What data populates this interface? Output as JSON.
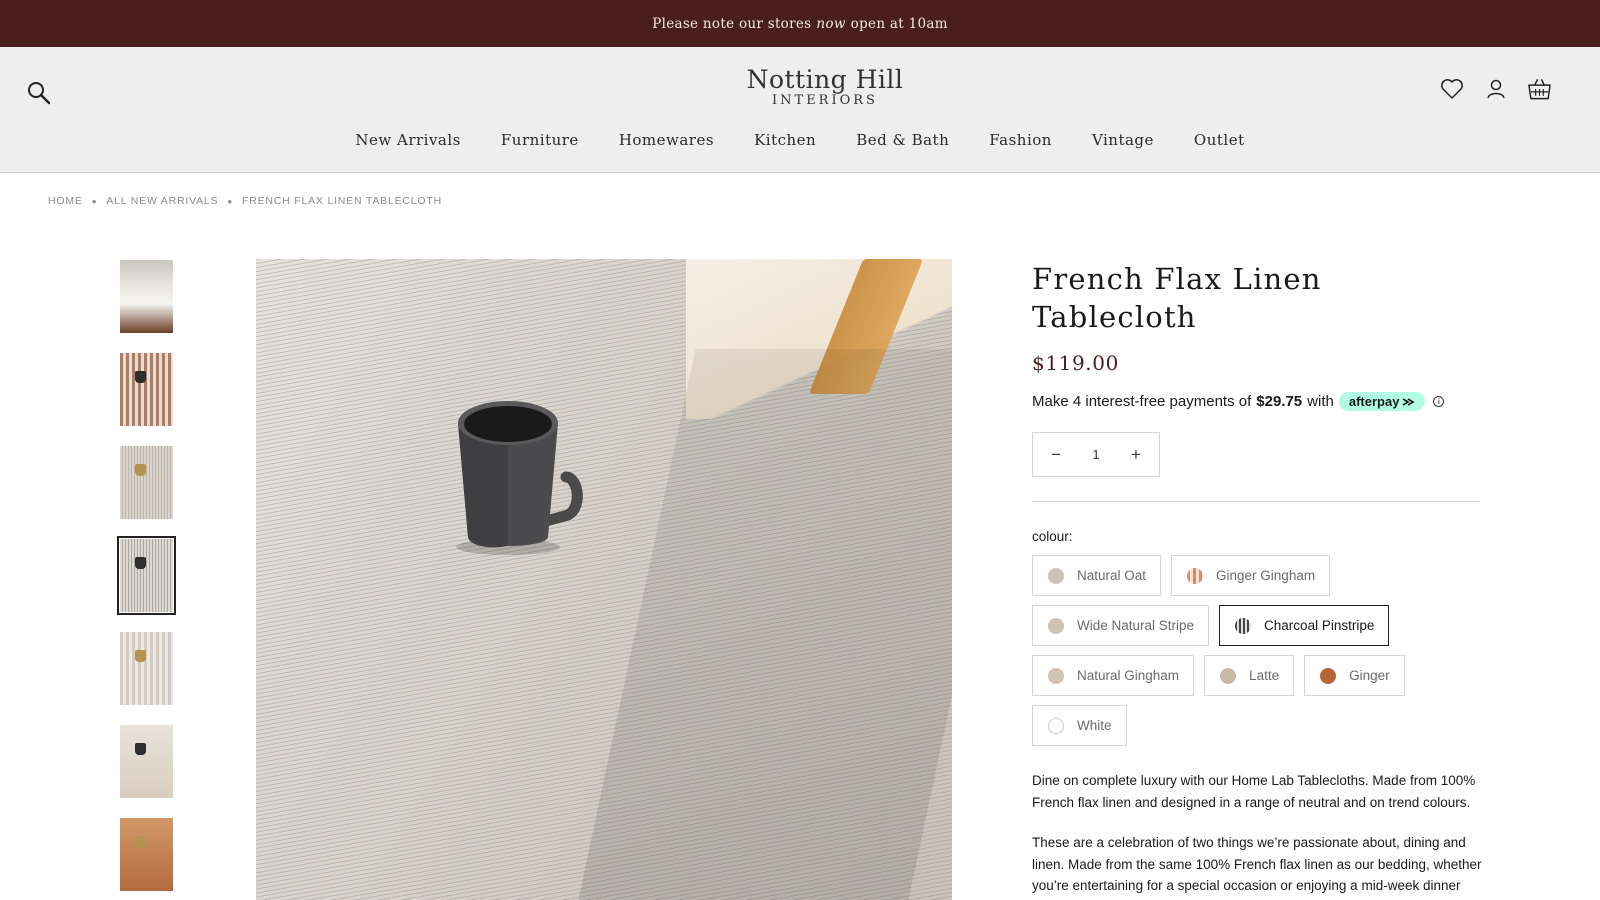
{
  "announcement": {
    "before": "Please note our stores",
    "emphasis": "now",
    "after": "open at 10am"
  },
  "header": {
    "logo_main": "Notting Hill",
    "logo_sub": "INTERIORS",
    "icons": [
      "search-icon",
      "heart-icon",
      "account-icon",
      "basket-icon"
    ],
    "nav": [
      "New Arrivals",
      "Furniture",
      "Homewares",
      "Kitchen",
      "Bed & Bath",
      "Fashion",
      "Vintage",
      "Outlet"
    ]
  },
  "breadcrumb": [
    "HOME",
    "ALL NEW ARRIVALS",
    "FRENCH FLAX LINEN TABLECLOTH"
  ],
  "product": {
    "title": "French Flax Linen Tablecloth",
    "price": "$119.00",
    "afterpay": {
      "prefix": "Make 4 interest-free payments of",
      "amount": "$29.75",
      "suffix": "with",
      "brand": "afterpay",
      "info_icon": "info-icon"
    },
    "quantity": "1",
    "colour_label": "colour:",
    "colours": [
      {
        "name": "Natural Oat",
        "color": "#cfc3b1"
      },
      {
        "name": "Ginger Gingham",
        "color": "#c98f67"
      },
      {
        "name": "Wide Natural Stripe",
        "color": "#cfc3b1"
      },
      {
        "name": "Charcoal Pinstripe",
        "color": "#555555",
        "selected": true
      },
      {
        "name": "Natural Gingham",
        "color": "#cfc3b1"
      },
      {
        "name": "Latte",
        "color": "#c9b9a6"
      },
      {
        "name": "Ginger",
        "color": "#b56533"
      },
      {
        "name": "White",
        "color": "#ffffff"
      }
    ],
    "description": [
      "Dine on complete luxury with our Home Lab Tablecloths. Made from 100% French flax linen and designed in a range of neutral and on trend colours.",
      "These are a celebration of two things we’re passionate about, dining and linen. Made from the same 100% French flax linen as our bedding, whether you’re entertaining for a special occasion or enjoying a mid-week dinner with your family or friends our"
    ]
  },
  "colors": {
    "announcement_bg": "#4a1e1e",
    "header_bg": "#eeeeee",
    "price": "#4a1e1e",
    "afterpay_badge": "#b2fce4"
  }
}
